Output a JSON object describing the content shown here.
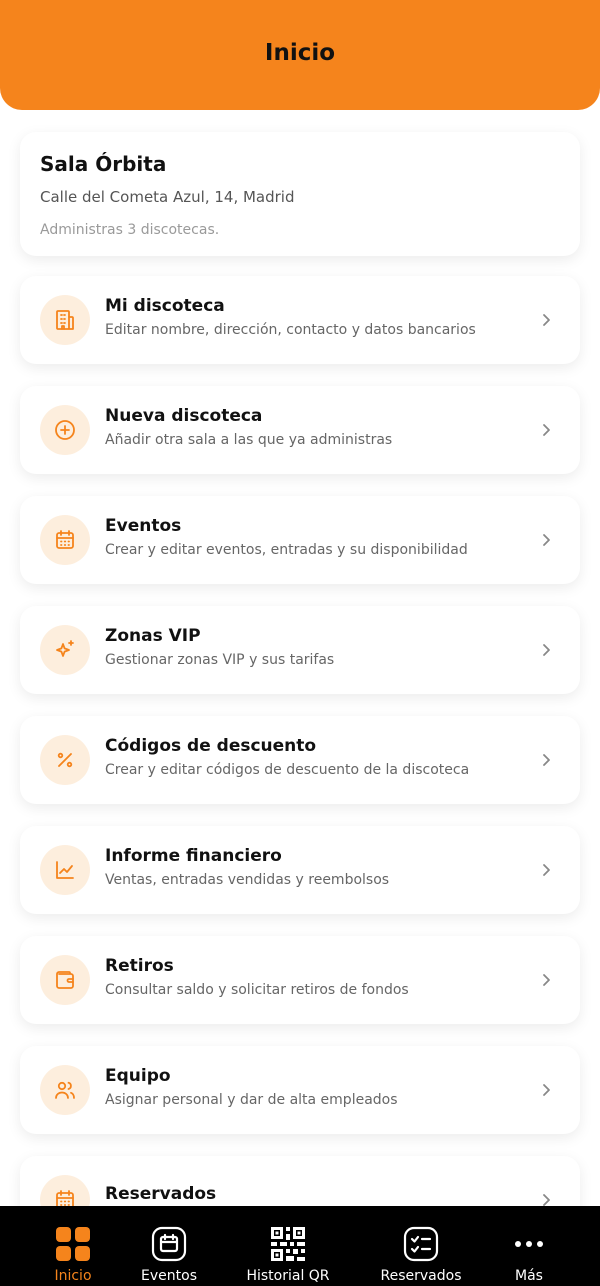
{
  "header": {
    "title": "Inicio"
  },
  "venue": {
    "name": "Sala Órbita",
    "address": "Calle del Cometa Azul, 14, Madrid",
    "note": "Administras 3 discotecas."
  },
  "menu": [
    {
      "title": "Mi discoteca",
      "subtitle": "Editar nombre, dirección, contacto y datos bancarios",
      "icon": "building-icon"
    },
    {
      "title": "Nueva discoteca",
      "subtitle": "Añadir otra sala a las que ya administras",
      "icon": "plus-circle-icon"
    },
    {
      "title": "Eventos",
      "subtitle": "Crear y editar eventos, entradas y su disponibilidad",
      "icon": "calendar-icon"
    },
    {
      "title": "Zonas VIP",
      "subtitle": "Gestionar zonas VIP y sus tarifas",
      "icon": "sparkles-icon"
    },
    {
      "title": "Códigos de descuento",
      "subtitle": "Crear y editar códigos de descuento de la discoteca",
      "icon": "percent-icon"
    },
    {
      "title": "Informe financiero",
      "subtitle": "Ventas, entradas vendidas y reembolsos",
      "icon": "chart-icon"
    },
    {
      "title": "Retiros",
      "subtitle": "Consultar saldo y solicitar retiros de fondos",
      "icon": "wallet-icon"
    },
    {
      "title": "Equipo",
      "subtitle": "Asignar personal y dar de alta empleados",
      "icon": "users-icon"
    },
    {
      "title": "Reservados",
      "subtitle": "",
      "icon": "calendar-icon"
    }
  ],
  "nav": [
    {
      "label": "Inicio",
      "icon": "grid-icon",
      "active": true
    },
    {
      "label": "Eventos",
      "icon": "calendar-icon",
      "active": false
    },
    {
      "label": "Historial QR",
      "icon": "qr-code-icon",
      "active": false
    },
    {
      "label": "Reservados",
      "icon": "checklist-icon",
      "active": false
    },
    {
      "label": "Más",
      "icon": "more-icon",
      "active": false
    }
  ],
  "colors": {
    "accent": "#f5841c",
    "icon_bg": "#fdeedd",
    "nav_bg": "#000000"
  }
}
